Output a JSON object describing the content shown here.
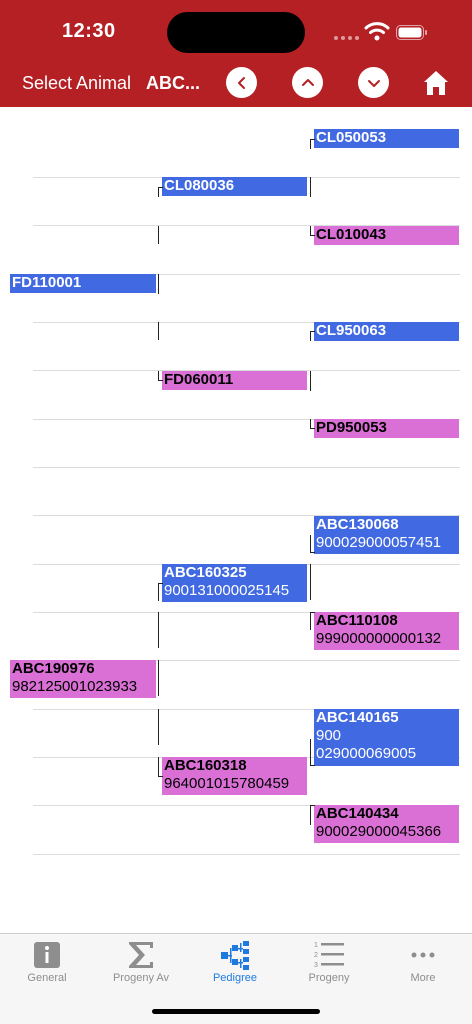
{
  "status": {
    "time": "12:30"
  },
  "nav": {
    "label": "Select Animal",
    "value": "ABC..."
  },
  "pedigree": [
    {
      "id": "n1",
      "lines": [
        "CL050053"
      ],
      "sex": "male"
    },
    {
      "id": "n2",
      "lines": [
        "CL080036"
      ],
      "sex": "male"
    },
    {
      "id": "n3",
      "lines": [
        "CL010043"
      ],
      "sex": "female"
    },
    {
      "id": "n4",
      "lines": [
        "FD110001"
      ],
      "sex": "male"
    },
    {
      "id": "n5",
      "lines": [
        "CL950063"
      ],
      "sex": "male"
    },
    {
      "id": "n6",
      "lines": [
        "FD060011"
      ],
      "sex": "female"
    },
    {
      "id": "n7",
      "lines": [
        "PD950053"
      ],
      "sex": "female"
    },
    {
      "id": "n8",
      "lines": [
        "ABC130068",
        "900029000057451"
      ],
      "sex": "male"
    },
    {
      "id": "n9",
      "lines": [
        "ABC160325",
        "900131000025145"
      ],
      "sex": "male"
    },
    {
      "id": "n10",
      "lines": [
        "ABC110108",
        "999000000000132"
      ],
      "sex": "female"
    },
    {
      "id": "n11",
      "lines": [
        "ABC190976",
        "982125001023933"
      ],
      "sex": "female"
    },
    {
      "id": "n12",
      "lines": [
        "ABC140165",
        "900",
        "029000069005"
      ],
      "sex": "male"
    },
    {
      "id": "n13",
      "lines": [
        "ABC160318",
        "964001015780459"
      ],
      "sex": "female"
    },
    {
      "id": "n14",
      "lines": [
        "ABC140434",
        "900029000045366"
      ],
      "sex": "female"
    }
  ],
  "tabs": [
    {
      "label": "General",
      "icon": "info-icon",
      "active": false
    },
    {
      "label": "Progeny Av",
      "icon": "sigma-icon",
      "active": false
    },
    {
      "label": "Pedigree",
      "icon": "pedigree-icon",
      "active": true
    },
    {
      "label": "Progeny",
      "icon": "numbered-list-icon",
      "active": false
    },
    {
      "label": "More",
      "icon": "more-icon",
      "active": false
    }
  ],
  "colors": {
    "header": "#b52024",
    "male": "#4169e1",
    "female": "#da70d6",
    "active_tab": "#1f7ae0",
    "inactive_tab": "#8e8e8e"
  }
}
